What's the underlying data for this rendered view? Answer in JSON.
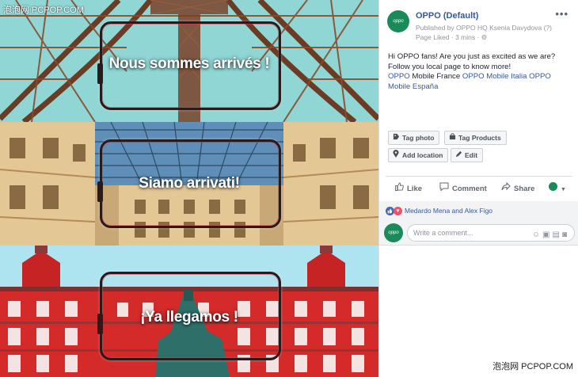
{
  "watermark": {
    "top_left": "泡泡网 PCPOP.COM",
    "bottom_right": "泡泡网 PCPOP.COM"
  },
  "photos": [
    {
      "slogan": "Nous sommes arrivés !"
    },
    {
      "slogan": "Siamo arrivati!"
    },
    {
      "slogan": "¡Ya llegamos !"
    }
  ],
  "post": {
    "avatar_text": "oppo",
    "page_name": "OPPO (Default)",
    "published_by": "Published by OPPO HQ Ksenia Davydova (?)",
    "liked_line": "Page Liked · 3 mins · ⚙",
    "more_label": "•••",
    "text_line1": "Hi OPPO fans! Are you just as excited as we are?",
    "text_line2": "Follow you local page to know more!",
    "links": {
      "france": "OPPO",
      "france_rest": " Mobile France ",
      "italia": "OPPO Mobile Italia",
      "espana_a": "OPPO",
      "espana_b": "Mobile España"
    },
    "tag_photo": "Tag photo",
    "tag_products": "Tag Products",
    "add_location": "Add location",
    "edit": "Edit",
    "like": "Like",
    "comment": "Comment",
    "share": "Share",
    "reactions_names": "Medardo Mena and Alex Figo",
    "comment_placeholder": "Write a comment..."
  },
  "icons": {
    "tag_photo": "tag-icon",
    "tag_products": "shopping-bag-icon",
    "add_location": "location-pin-icon",
    "edit": "pencil-icon",
    "like": "thumbs-up-icon",
    "comment": "speech-bubble-icon",
    "share": "share-arrow-icon"
  },
  "colors": {
    "link": "#385898",
    "brand_green": "#1a8a5a",
    "like_blue": "#4267b2",
    "love_red": "#f25268"
  }
}
